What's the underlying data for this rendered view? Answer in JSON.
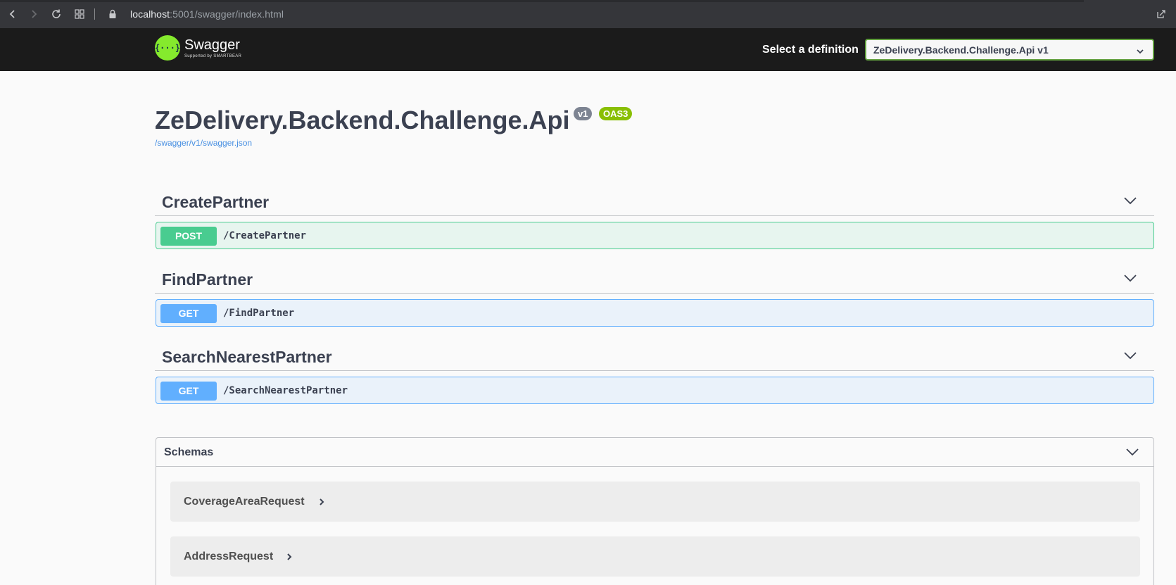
{
  "browser": {
    "url_host": "localhost",
    "url_rest": ":5001/swagger/index.html"
  },
  "topbar": {
    "logo_symbol": "{···}",
    "logo_text": "Swagger",
    "logo_sub": "Supported by SMARTBEAR",
    "definition_label": "Select a definition",
    "definition_value": "ZeDelivery.Backend.Challenge.Api v1"
  },
  "info": {
    "title": "ZeDelivery.Backend.Challenge.Api",
    "version_badge": "v1",
    "oas_badge": "OAS3",
    "spec_url": "/swagger/v1/swagger.json"
  },
  "tags": [
    {
      "name": "CreatePartner",
      "method": "POST",
      "path": "/CreatePartner"
    },
    {
      "name": "FindPartner",
      "method": "GET",
      "path": "/FindPartner"
    },
    {
      "name": "SearchNearestPartner",
      "method": "GET",
      "path": "/SearchNearestPartner"
    }
  ],
  "schemas": {
    "title": "Schemas",
    "models": [
      "CoverageAreaRequest",
      "AddressRequest"
    ]
  },
  "colors": {
    "post": "#49cc90",
    "get": "#61affe",
    "topbar": "#1b1b1b",
    "badge_oas": "#89bf04"
  }
}
